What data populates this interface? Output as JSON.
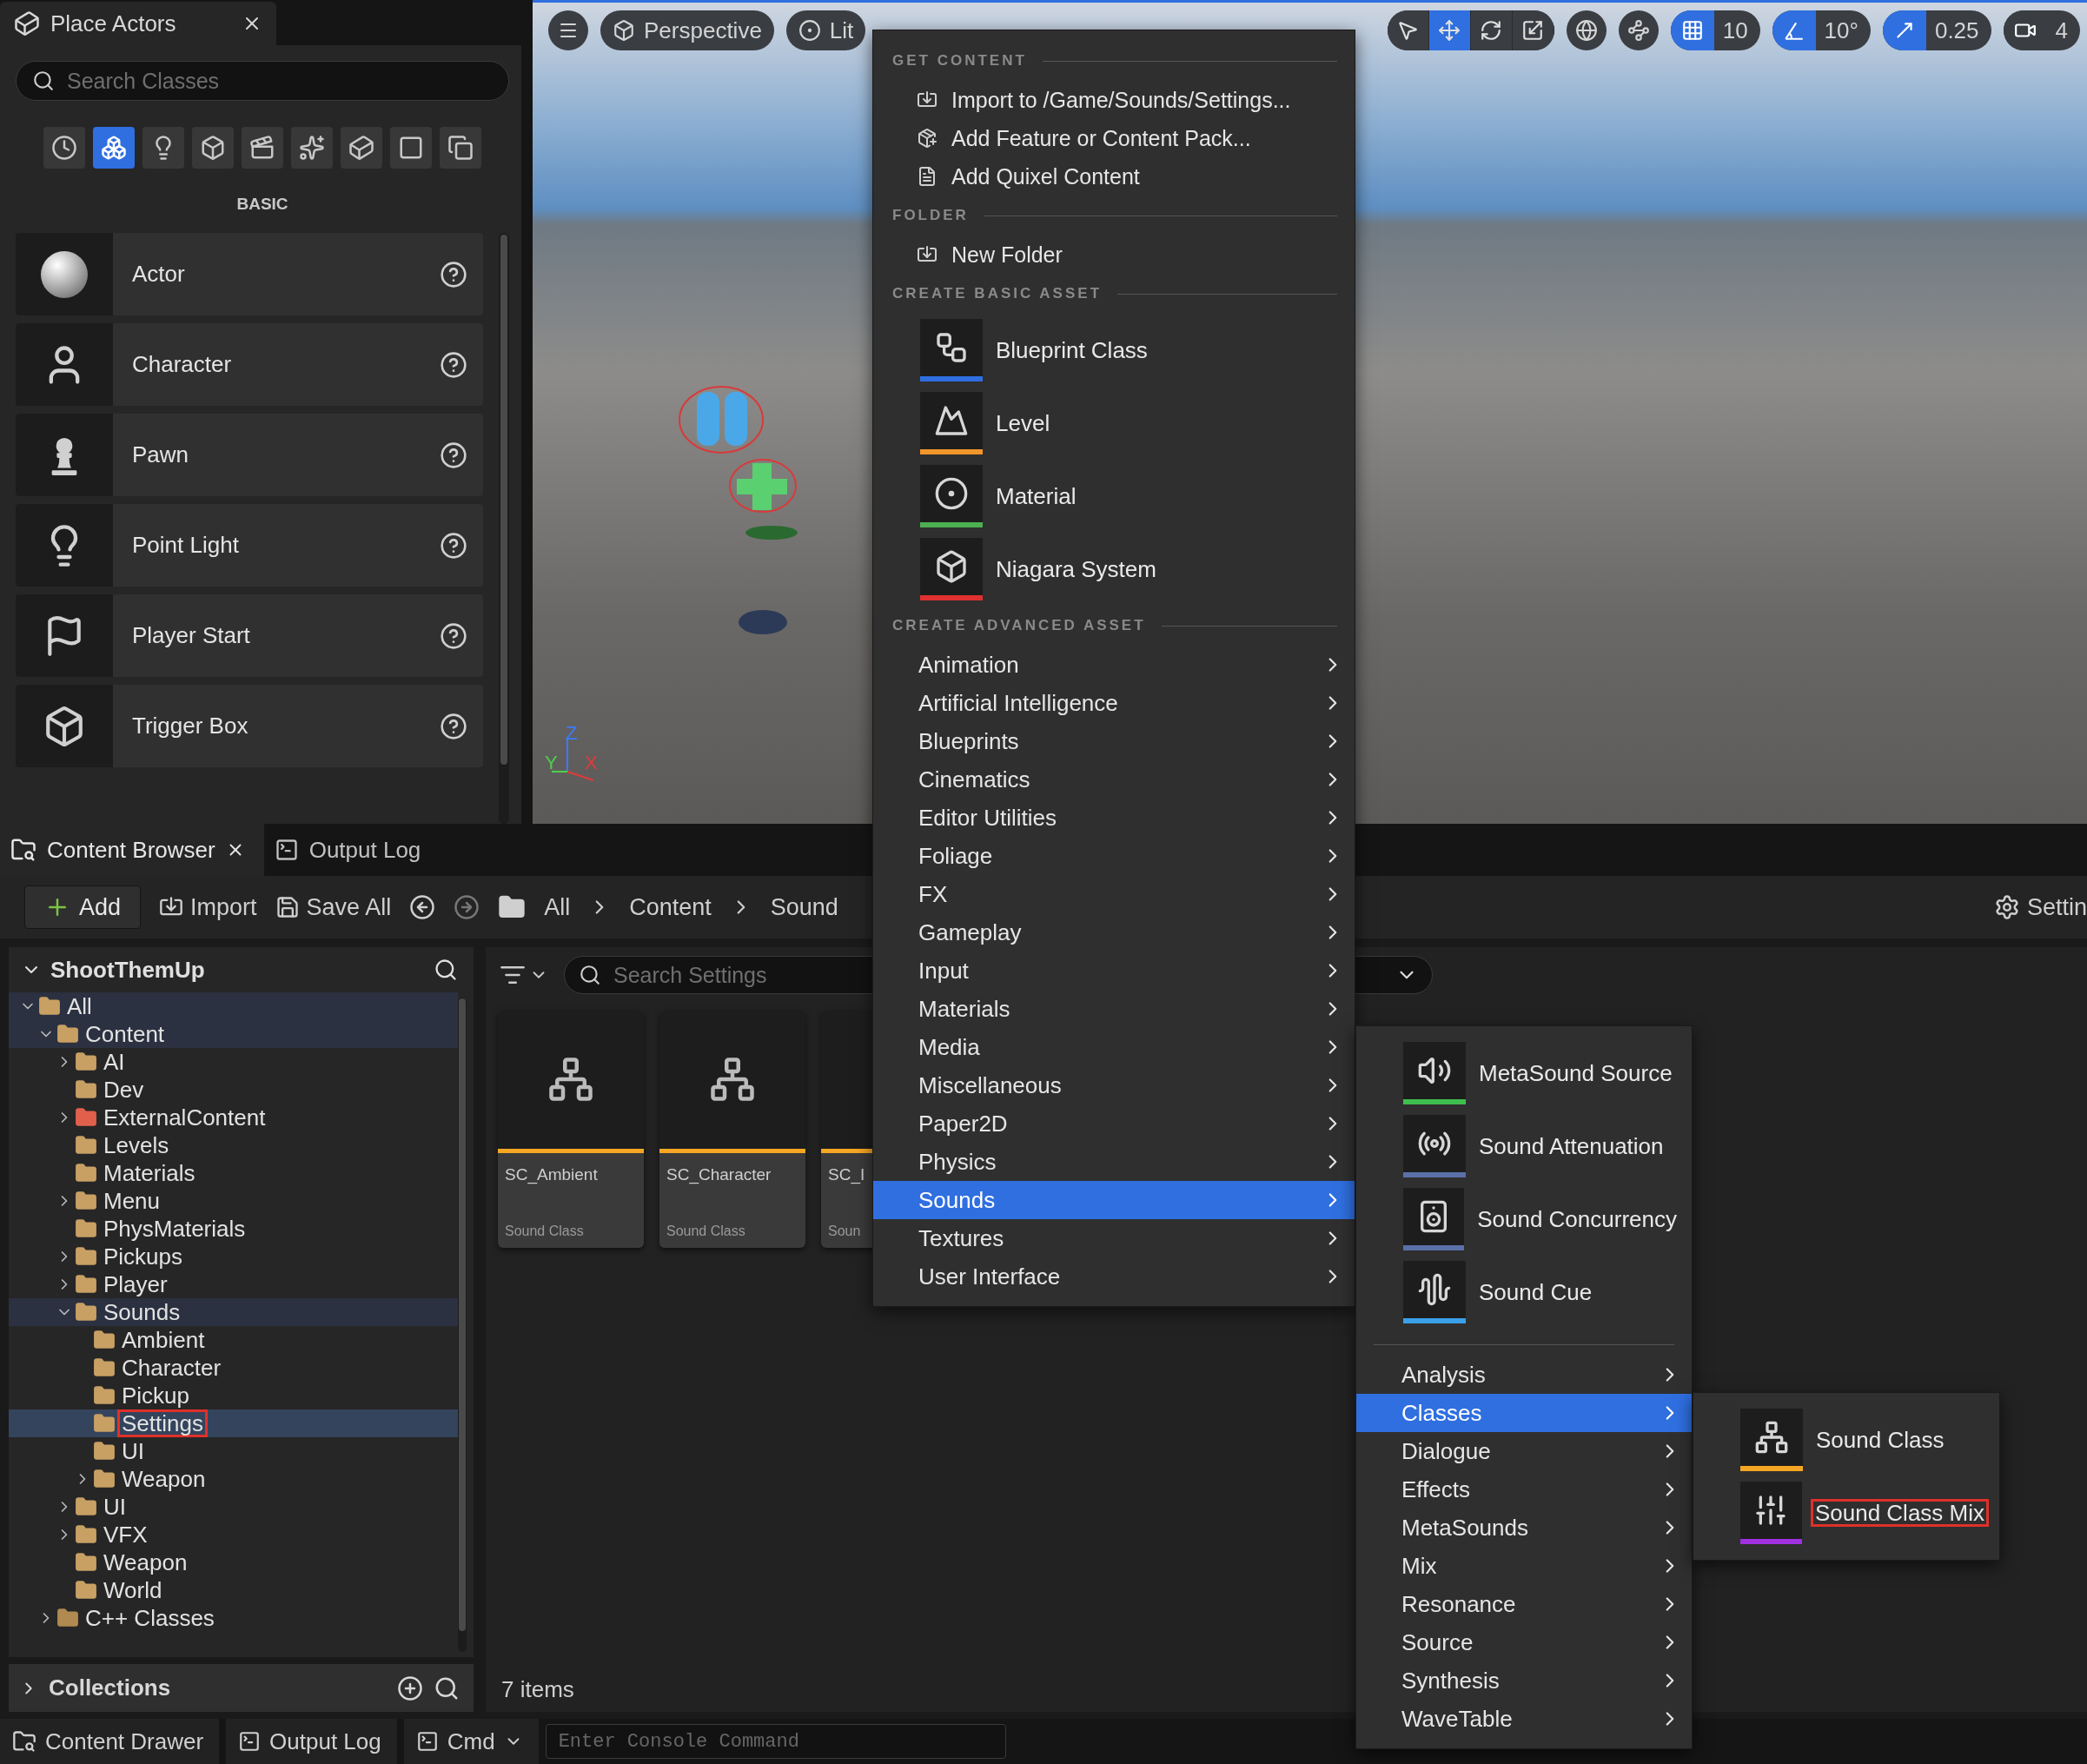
{
  "place_actors": {
    "tab_title": "Place Actors",
    "search": {
      "placeholder": "Search Classes"
    },
    "categories": [
      {
        "selected": false
      },
      {
        "selected": true
      },
      {
        "selected": false
      },
      {
        "selected": false
      },
      {
        "selected": false
      },
      {
        "selected": false
      },
      {
        "selected": false
      },
      {
        "selected": false
      },
      {
        "selected": false
      }
    ],
    "category_label": "BASIC",
    "items": [
      {
        "label": "Actor"
      },
      {
        "label": "Character"
      },
      {
        "label": "Pawn"
      },
      {
        "label": "Point Light"
      },
      {
        "label": "Player Start"
      },
      {
        "label": "Trigger Box"
      }
    ]
  },
  "viewport": {
    "view_buttons": [
      {
        "label": "Perspective"
      },
      {
        "label": "Lit"
      }
    ],
    "transform_tools": [
      {
        "selected": false
      },
      {
        "selected": true
      },
      {
        "selected": false
      },
      {
        "selected": false
      }
    ],
    "snaps": [
      {
        "kind": "grid",
        "value": "10",
        "on": true
      },
      {
        "kind": "angle",
        "value": "10°",
        "on": true
      },
      {
        "kind": "scale",
        "value": "0.25",
        "on": true
      },
      {
        "kind": "camera",
        "value": "4",
        "on": false
      }
    ],
    "axis_labels": [
      "Z",
      "Y",
      "X"
    ]
  },
  "content_browser": {
    "tabs": [
      {
        "label": "Content Browser",
        "selected": true
      },
      {
        "label": "Output Log",
        "selected": false
      }
    ],
    "toolbar": {
      "add": "Add",
      "import": "Import",
      "save_all": "Save All",
      "breadcrumb": [
        "All",
        "Content",
        "Sound"
      ],
      "settings": "Settin"
    },
    "tree": {
      "title": "ShootThemUp",
      "items": [
        {
          "label": "All",
          "kind": "expanded",
          "selected": false,
          "outlined": false,
          "color": "#c8a064",
          "children": [
            {
              "label": "Content",
              "kind": "expanded",
              "selected": false,
              "outlined": false,
              "color": "#c8a064",
              "children": [
                {
                  "label": "AI",
                  "kind": "collapsed",
                  "selected": false,
                  "outlined": false,
                  "color": "#c8a064"
                },
                {
                  "label": "Dev",
                  "kind": "leaf",
                  "selected": false,
                  "outlined": false,
                  "color": "#c8a064"
                },
                {
                  "label": "ExternalContent",
                  "kind": "collapsed",
                  "selected": false,
                  "outlined": false,
                  "color": "#e0604c"
                },
                {
                  "label": "Levels",
                  "kind": "leaf",
                  "selected": false,
                  "outlined": false,
                  "color": "#c8a064"
                },
                {
                  "label": "Materials",
                  "kind": "leaf",
                  "selected": false,
                  "outlined": false,
                  "color": "#c8a064"
                },
                {
                  "label": "Menu",
                  "kind": "collapsed",
                  "selected": false,
                  "outlined": false,
                  "color": "#c8a064"
                },
                {
                  "label": "PhysMaterials",
                  "kind": "leaf",
                  "selected": false,
                  "outlined": false,
                  "color": "#c8a064"
                },
                {
                  "label": "Pickups",
                  "kind": "collapsed",
                  "selected": false,
                  "outlined": false,
                  "color": "#c8a064"
                },
                {
                  "label": "Player",
                  "kind": "collapsed",
                  "selected": false,
                  "outlined": false,
                  "color": "#c8a064"
                },
                {
                  "label": "Sounds",
                  "kind": "expanded",
                  "selected": false,
                  "outlined": false,
                  "color": "#c8a064",
                  "children": [
                    {
                      "label": "Ambient",
                      "kind": "leaf",
                      "selected": false,
                      "outlined": false,
                      "color": "#c8a064"
                    },
                    {
                      "label": "Character",
                      "kind": "leaf",
                      "selected": false,
                      "outlined": false,
                      "color": "#c8a064"
                    },
                    {
                      "label": "Pickup",
                      "kind": "leaf",
                      "selected": false,
                      "outlined": false,
                      "color": "#c8a064"
                    },
                    {
                      "label": "Settings",
                      "kind": "leaf",
                      "selected": true,
                      "outlined": true,
                      "color": "#c8a064"
                    },
                    {
                      "label": "UI",
                      "kind": "leaf",
                      "selected": false,
                      "outlined": false,
                      "color": "#c8a064"
                    },
                    {
                      "label": "Weapon",
                      "kind": "collapsed",
                      "selected": false,
                      "outlined": false,
                      "color": "#c8a064"
                    }
                  ]
                },
                {
                  "label": "UI",
                  "kind": "collapsed",
                  "selected": false,
                  "outlined": false,
                  "color": "#c8a064"
                },
                {
                  "label": "VFX",
                  "kind": "collapsed",
                  "selected": false,
                  "outlined": false,
                  "color": "#c8a064"
                },
                {
                  "label": "Weapon",
                  "kind": "leaf",
                  "selected": false,
                  "outlined": false,
                  "color": "#c8a064"
                },
                {
                  "label": "World",
                  "kind": "leaf",
                  "selected": false,
                  "outlined": false,
                  "color": "#c8a064"
                }
              ]
            },
            {
              "label": "C++ Classes",
              "kind": "collapsed",
              "selected": false,
              "outlined": false,
              "color": "#b08a50"
            }
          ]
        }
      ]
    },
    "collections": "Collections",
    "filter": {
      "placeholder": "Search Settings"
    },
    "assets": [
      {
        "name": "SC_Ambient",
        "type": "Sound Class",
        "color": "#f5a623"
      },
      {
        "name": "SC_Character",
        "type": "Sound Class",
        "color": "#f5a623"
      },
      {
        "name": "SC_I",
        "type": "Soun",
        "color": "#f5a623"
      }
    ],
    "item_count": "7 items"
  },
  "context_menu": {
    "sections": [
      {
        "header": "GET CONTENT",
        "items": [
          {
            "kind": "action",
            "label": "Import to /Game/Sounds/Settings..."
          },
          {
            "kind": "action",
            "label": "Add Feature or Content Pack..."
          },
          {
            "kind": "action",
            "label": "Add Quixel Content"
          }
        ]
      },
      {
        "header": "FOLDER",
        "items": [
          {
            "kind": "action",
            "label": "New Folder"
          }
        ]
      },
      {
        "header": "CREATE BASIC ASSET",
        "items": [
          {
            "kind": "asset",
            "label": "Blueprint Class",
            "color": "#2f6fe0"
          },
          {
            "kind": "asset",
            "label": "Level",
            "color": "#f0962a"
          },
          {
            "kind": "asset",
            "label": "Material",
            "color": "#4cb050"
          },
          {
            "kind": "asset",
            "label": "Niagara System",
            "color": "#e03030"
          }
        ]
      },
      {
        "header": "CREATE ADVANCED ASSET",
        "items": [
          {
            "kind": "submenu",
            "label": "Animation",
            "selected": false
          },
          {
            "kind": "submenu",
            "label": "Artificial Intelligence",
            "selected": false
          },
          {
            "kind": "submenu",
            "label": "Blueprints",
            "selected": false
          },
          {
            "kind": "submenu",
            "label": "Cinematics",
            "selected": false
          },
          {
            "kind": "submenu",
            "label": "Editor Utilities",
            "selected": false
          },
          {
            "kind": "submenu",
            "label": "Foliage",
            "selected": false
          },
          {
            "kind": "submenu",
            "label": "FX",
            "selected": false
          },
          {
            "kind": "submenu",
            "label": "Gameplay",
            "selected": false
          },
          {
            "kind": "submenu",
            "label": "Input",
            "selected": false
          },
          {
            "kind": "submenu",
            "label": "Materials",
            "selected": false
          },
          {
            "kind": "submenu",
            "label": "Media",
            "selected": false
          },
          {
            "kind": "submenu",
            "label": "Miscellaneous",
            "selected": false
          },
          {
            "kind": "submenu",
            "label": "Paper2D",
            "selected": false
          },
          {
            "kind": "submenu",
            "label": "Physics",
            "selected": false
          },
          {
            "kind": "submenu",
            "label": "Sounds",
            "selected": true
          },
          {
            "kind": "submenu",
            "label": "Textures",
            "selected": false
          },
          {
            "kind": "submenu",
            "label": "User Interface",
            "selected": false
          }
        ]
      }
    ]
  },
  "sounds_menu": {
    "sections": [
      {
        "items": [
          {
            "kind": "asset",
            "label": "MetaSound Source",
            "color": "#3fbf4f"
          },
          {
            "kind": "asset",
            "label": "Sound Attenuation",
            "color": "#5a70a8"
          },
          {
            "kind": "asset",
            "label": "Sound Concurrency",
            "color": "#5a70a8"
          },
          {
            "kind": "asset",
            "label": "Sound Cue",
            "color": "#3aa0e8"
          }
        ]
      },
      {
        "items": [
          {
            "kind": "submenu",
            "label": "Analysis",
            "selected": false
          },
          {
            "kind": "submenu",
            "label": "Classes",
            "selected": true
          },
          {
            "kind": "submenu",
            "label": "Dialogue",
            "selected": false
          },
          {
            "kind": "submenu",
            "label": "Effects",
            "selected": false
          },
          {
            "kind": "submenu",
            "label": "MetaSounds",
            "selected": false
          },
          {
            "kind": "submenu",
            "label": "Mix",
            "selected": false
          },
          {
            "kind": "submenu",
            "label": "Resonance",
            "selected": false
          },
          {
            "kind": "submenu",
            "label": "Source",
            "selected": false
          },
          {
            "kind": "submenu",
            "label": "Synthesis",
            "selected": false
          },
          {
            "kind": "submenu",
            "label": "WaveTable",
            "selected": false
          }
        ]
      }
    ]
  },
  "classes_menu": {
    "sections": [
      {
        "items": [
          {
            "kind": "asset",
            "label": "Sound Class",
            "color": "#f5a623",
            "outlined": false
          },
          {
            "kind": "asset",
            "label": "Sound Class Mix",
            "color": "#a030e0",
            "outlined": true
          }
        ]
      }
    ]
  },
  "status_bar": {
    "content_drawer": "Content Drawer",
    "output_log": "Output Log",
    "cmd": "Cmd",
    "console": {
      "placeholder": "Enter Console Command"
    }
  }
}
